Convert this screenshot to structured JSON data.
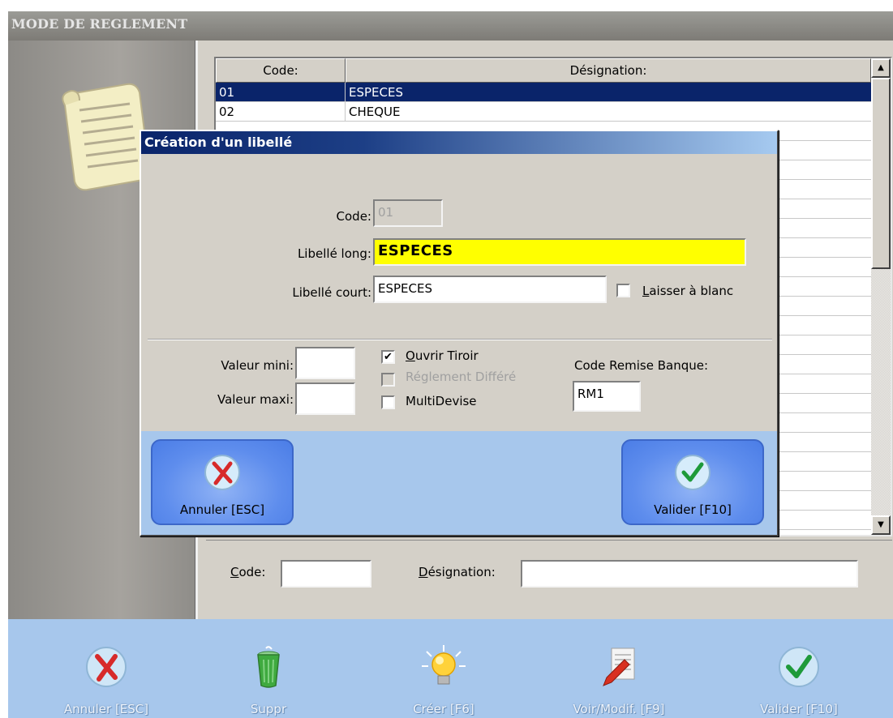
{
  "window": {
    "title": "MODE DE REGLEMENT"
  },
  "grid": {
    "headers": [
      "Code:",
      "Désignation:"
    ],
    "rows": [
      {
        "code": "01",
        "designation": "ESPECES",
        "selected": true
      },
      {
        "code": "02",
        "designation": "CHEQUE",
        "selected": false
      }
    ]
  },
  "search": {
    "code_label": "Code:",
    "code_label_underline": "C",
    "code_label_rest": "ode:",
    "code_value": "",
    "designation_label_underline": "D",
    "designation_label_rest": "ésignation:",
    "designation_value": ""
  },
  "toolbar": {
    "cancel": "Annuler [ESC]",
    "delete": "Suppr",
    "create": "Créer [F6]",
    "edit": "Voir/Modif. [F9]",
    "validate": "Valider [F10]"
  },
  "dialog": {
    "title": "Création d'un libellé",
    "code_label": "Code:",
    "code_value": "01",
    "long_label": "Libellé long:",
    "long_value": "ESPECES",
    "short_label": "Libellé court:",
    "short_value": "ESPECES",
    "blank_underline": "L",
    "blank_rest": "aisser à blanc",
    "blank_checked": false,
    "min_label": "Valeur mini:",
    "min_value": "",
    "max_label": "Valeur maxi:",
    "max_value": "",
    "drawer_underline": "O",
    "drawer_rest": "uvrir Tiroir",
    "drawer_checked": true,
    "deferred_label": "Réglement Différé",
    "deferred_enabled": false,
    "multi_label": "MultiDevise",
    "multi_checked": false,
    "bank_label": "Code Remise Banque:",
    "bank_value": "RM1",
    "cancel": "Annuler [ESC]",
    "validate": "Valider [F10]"
  },
  "colors": {
    "selection": "#0a246a",
    "toolbar_bg": "#a7c7ec",
    "required_field": "#ffff00",
    "dialog_button": "#5e8ded"
  },
  "icons": {
    "document": "scroll-document-icon",
    "cancel": "red-x-icon",
    "validate": "green-check-icon",
    "delete": "trash-can-icon",
    "create": "light-bulb-icon",
    "edit": "pencil-document-icon"
  }
}
